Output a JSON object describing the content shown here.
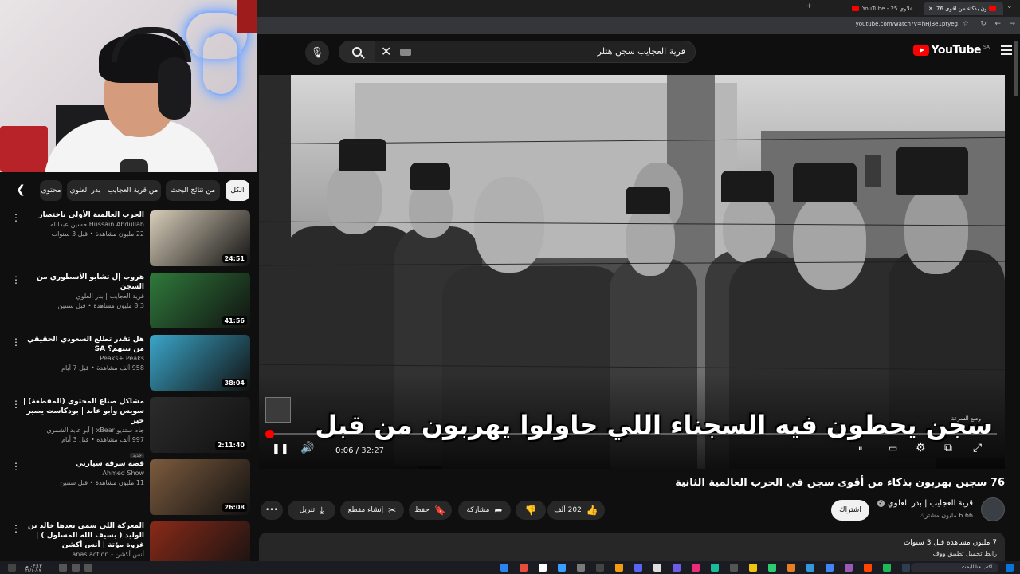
{
  "browser": {
    "tabs": [
      {
        "label": "76 سجين يهربون بذكاء من أقوى",
        "active": true
      },
      {
        "label": "YouTube - 25 علاوي",
        "active": false
      }
    ],
    "url": "youtube.com/watch?v=hHjBe1ptyeg",
    "new_tab": "+",
    "minimize": "—"
  },
  "youtube": {
    "search_query": "قرية العجايب سجن هتلر",
    "logo_text": "YouTube",
    "country_code": "SA"
  },
  "player": {
    "overlay_title": "سجن يحطون فيه السجناء اللي حاولوا يهربون من قبل",
    "watermark": "وضع السرعة",
    "time_current": "0:06",
    "time_duration": "32:27",
    "progress_fraction": 0.003
  },
  "video": {
    "title": "76 سجين يهربون بذكاء من أقوى سجن في الحرب العالمية الثانية",
    "channel": "قرية العجايب | بدر العلوي",
    "subscribers": "6.66 مليون مشترك",
    "subscribe_label": "اشتراك",
    "likes": "202 ألف",
    "share_label": "مشاركة",
    "save_label": "حفظ",
    "clip_label": "إنشاء مقطع",
    "download_label": "تنزيل",
    "more_label": "•••",
    "desc_line1": "7 مليون مشاهدة  قبل 3 سنوات",
    "desc_line2": "رابط تحميل تطبيق ووف"
  },
  "chips": [
    "الكل",
    "من نتائج البحث",
    "من قرية العجايب | بدر العلوي",
    "محتوى"
  ],
  "recommendations": [
    {
      "title": "الحرب العالمية الأولى باختصار",
      "channel": "Hussain Abdullah حسين عبدالله",
      "stats": "22 مليون مشاهدة • قبل 3 سنوات",
      "duration": "24:51",
      "thumb_color": "#d8cdb9",
      "new": ""
    },
    {
      "title": "هروب إل تشابو الأسطوري من السجن",
      "channel": "قرية العجايب | بدر العلوي",
      "stats": "8.3 مليون مشاهدة • قبل سنتين",
      "duration": "41:56",
      "thumb_color": "#2f7a3b",
      "new": ""
    },
    {
      "title": "هل تقدر تطلع السعودي الحقيقي من بينهم؟ SA",
      "channel": "Peaks+ Peaks",
      "stats": "958 ألف مشاهدة • قبل 7 أيام",
      "duration": "38:04",
      "thumb_color": "#3aa6c9",
      "new": ""
    },
    {
      "title": "مشاكل صناع المحتوى (المقطعة) | سويس وأبو عابد | بودكاست يصير خير",
      "channel": "جام ستديو xBear | أبو عابد الشمري",
      "stats": "997 ألف مشاهدة • قبل 3 أيام",
      "duration": "2:11:40",
      "thumb_color": "#2c2c2c",
      "new": "جديد"
    },
    {
      "title": "قصة سرقة سيارتي",
      "channel": "Ahmed Show",
      "stats": "11 مليون مشاهدة • قبل سنتين",
      "duration": "26:08",
      "thumb_color": "#7d5b3e",
      "new": ""
    },
    {
      "title": "المعركة اللي سمي بعدها خالد بن الوليد ( بسيف الله المسلول ) | غزوة مؤتة | أنس أكشن",
      "channel": "أنس أكشن - anas action",
      "stats": "",
      "duration": "",
      "thumb_color": "#8a2a18",
      "new": ""
    }
  ],
  "taskbar": {
    "time": "٠٣:١٣ م",
    "date": "٢٧/١٠/٠٧",
    "search_placeholder": "اكتب هنا للبحث"
  }
}
